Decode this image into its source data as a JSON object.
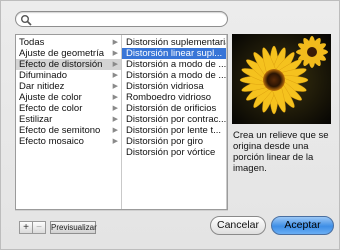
{
  "search": {
    "value": "",
    "placeholder": ""
  },
  "categories": [
    {
      "label": "Todas",
      "state": ""
    },
    {
      "label": "Ajuste de geometría",
      "state": ""
    },
    {
      "label": "Efecto de distorsión",
      "state": "selected"
    },
    {
      "label": "Difuminado",
      "state": ""
    },
    {
      "label": "Dar nitidez",
      "state": ""
    },
    {
      "label": "Ajuste de color",
      "state": ""
    },
    {
      "label": "Efecto de color",
      "state": ""
    },
    {
      "label": "Estilizar",
      "state": ""
    },
    {
      "label": "Efecto de semitono",
      "state": ""
    },
    {
      "label": "Efecto mosaico",
      "state": ""
    }
  ],
  "effects": [
    {
      "label": "Distorsión suplementaria",
      "state": ""
    },
    {
      "label": "Distorsión linear supl...",
      "state": "selected"
    },
    {
      "label": "Distorsión a modo de ...",
      "state": ""
    },
    {
      "label": "Distorsión a modo de ...",
      "state": ""
    },
    {
      "label": "Distorsión vidriosa",
      "state": ""
    },
    {
      "label": "Romboedro vidrioso",
      "state": ""
    },
    {
      "label": "Distorsión de orificios",
      "state": ""
    },
    {
      "label": "Distorsión por contrac...",
      "state": ""
    },
    {
      "label": "Distorsión por lente t...",
      "state": ""
    },
    {
      "label": "Distorsión por giro",
      "state": ""
    },
    {
      "label": "Distorsión por vórtice",
      "state": ""
    }
  ],
  "description": "Crea un relieve que se origina desde una porción linear de la imagen.",
  "buttons": {
    "add": "+",
    "remove": "−",
    "preview": "Previsualizar",
    "cancel": "Cancelar",
    "accept": "Aceptar"
  },
  "colors": {
    "selection_blue": "#3875d7",
    "selection_grey": "#d4d4d4",
    "default_button": "#3e8ee6"
  }
}
